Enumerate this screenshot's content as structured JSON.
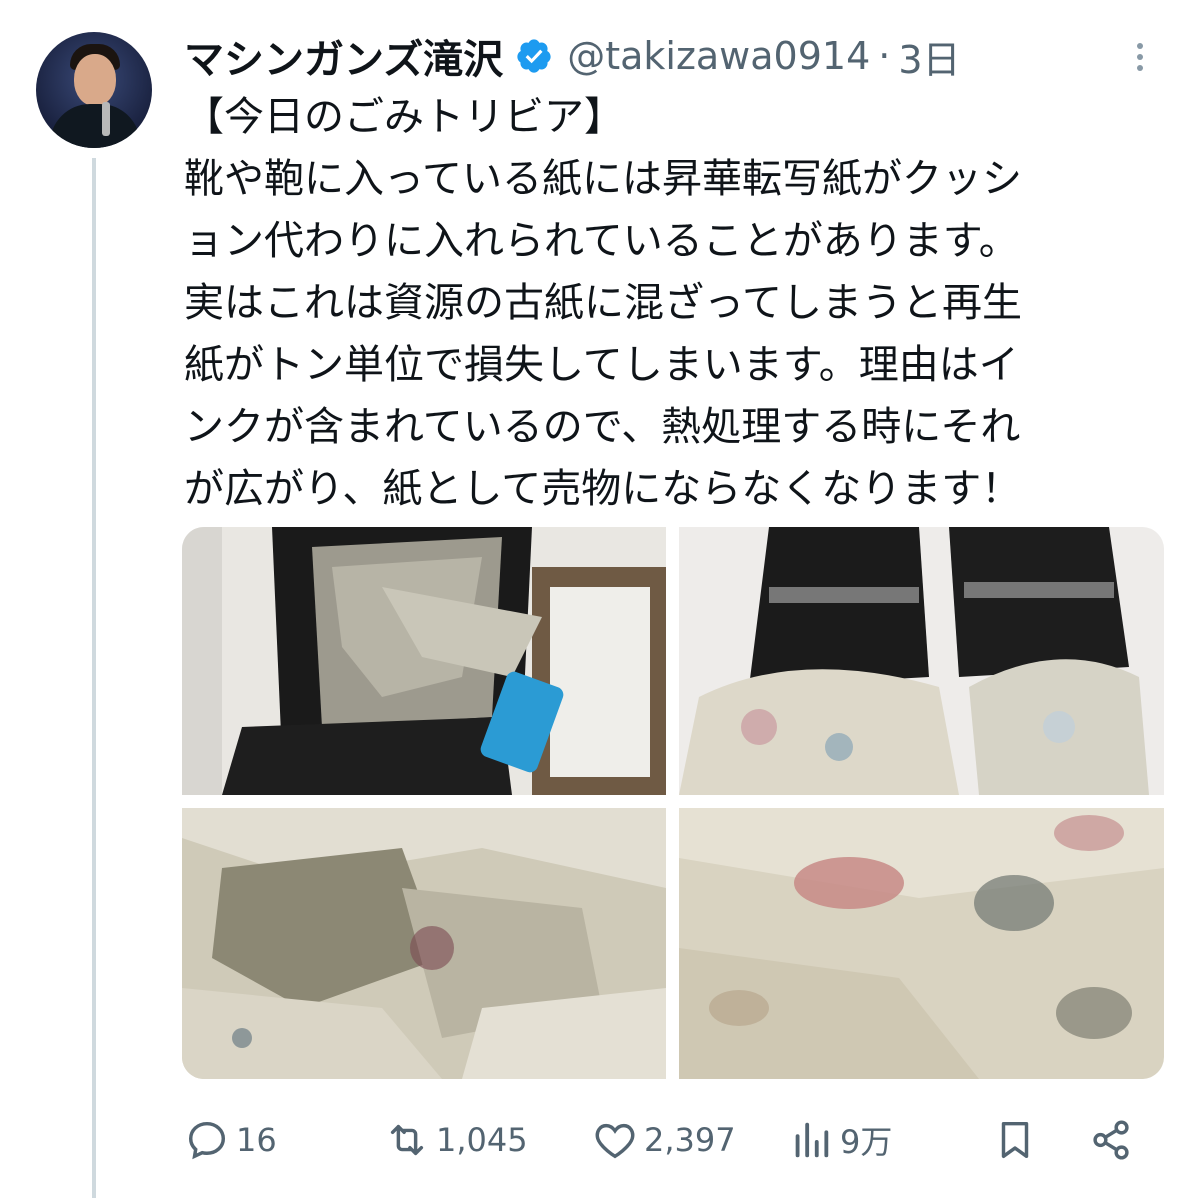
{
  "author": {
    "display_name": "マシンガンズ滝沢",
    "handle": "@takizawa0914",
    "separator": "·",
    "posted": "3日",
    "verified": true
  },
  "tweet": {
    "lines": [
      "【今日のごみトリビア】",
      "靴や鞄に入っている紙には昇華転写紙がクッシ",
      "ョン代わりに入れられていることがあります。",
      "実はこれは資源の古紙に混ざってしまうと再生",
      "紙がトン単位で損失してしまいます。理由はイ",
      "ンクが含まれているので、熱処理する時にそれ",
      "が広がり、紙として売物にならなくなります！"
    ]
  },
  "media": [
    {
      "icon": "photo-shoe-in-box"
    },
    {
      "icon": "photo-loafers-with-paper"
    },
    {
      "icon": "photo-crumpled-paper"
    },
    {
      "icon": "photo-fish-print-paper"
    }
  ],
  "actions": {
    "replies": "16",
    "reposts": "1,045",
    "likes": "2,397",
    "views": "9万"
  },
  "colors": {
    "text": "#0f1419",
    "secondary": "#536471",
    "verified": "#1d9bf0",
    "thread_line": "#cfd9de"
  }
}
